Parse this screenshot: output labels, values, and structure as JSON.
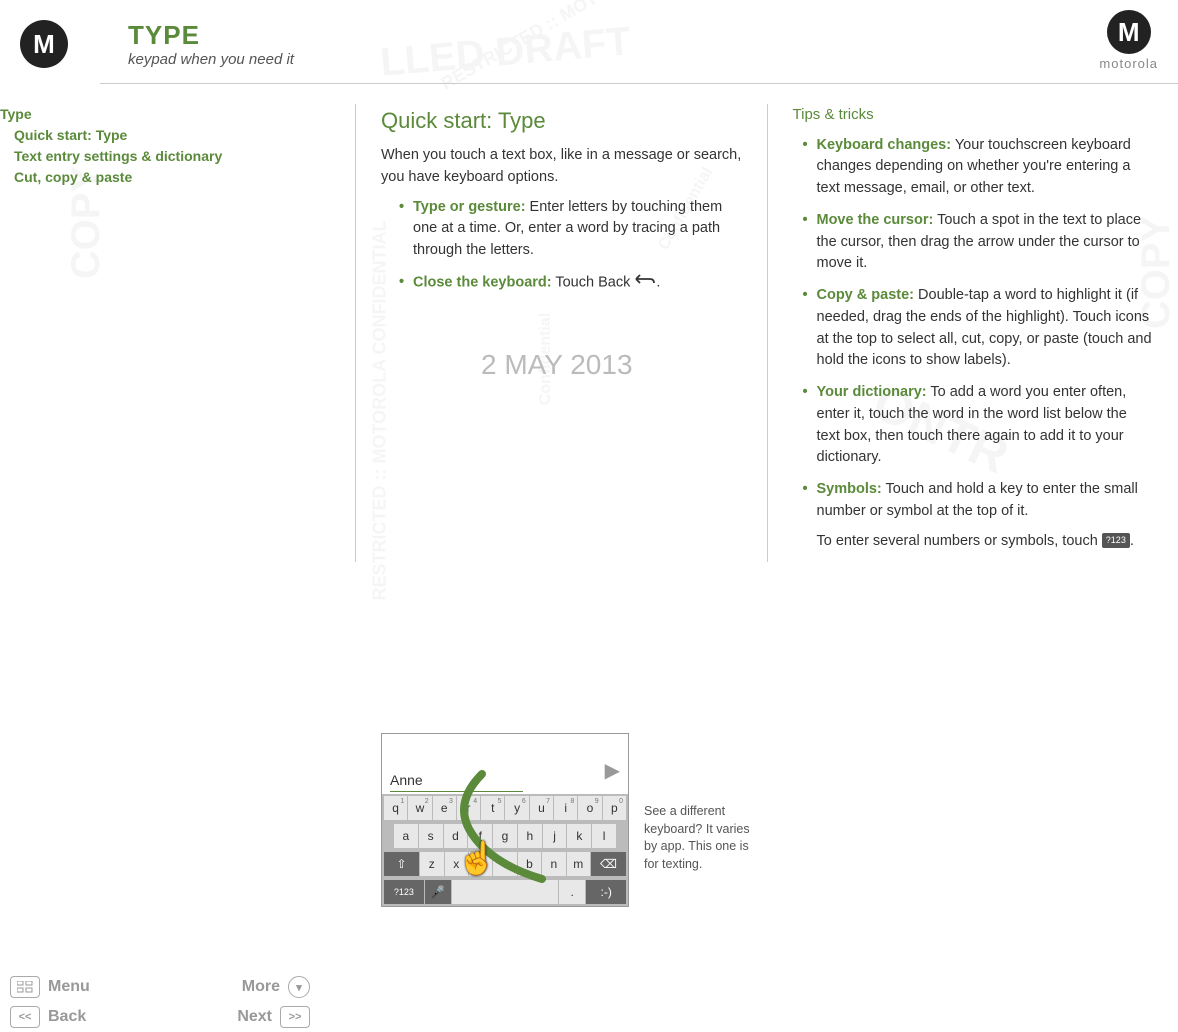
{
  "header": {
    "title": "TYPE",
    "subtitle": "keypad when you need it",
    "brand": "motorola"
  },
  "toc": {
    "root": "Type",
    "items": [
      "Quick start: Type",
      "Text entry settings & dictionary",
      "Cut, copy & paste"
    ]
  },
  "nav": {
    "menu": "Menu",
    "more": "More",
    "back": "Back",
    "next": "Next"
  },
  "col1": {
    "heading": "Quick start: Type",
    "intro": "When you touch a text box, like in a message or search, you have keyboard options.",
    "bullets": [
      {
        "label": "Type or gesture:",
        "text": " Enter letters by touching them one at a time. Or, enter a word by tracing a path through the letters."
      },
      {
        "label": "Close the keyboard:",
        "text": " Touch Back "
      }
    ],
    "date_stamp": "2 MAY 2013",
    "keyboard": {
      "typed": "Anne",
      "caption": "See a different keyboard? It varies by app. This one is for texting.",
      "row1": [
        [
          "q",
          "1"
        ],
        [
          "w",
          "2"
        ],
        [
          "e",
          "3"
        ],
        [
          "r",
          "4"
        ],
        [
          "t",
          "5"
        ],
        [
          "y",
          "6"
        ],
        [
          "u",
          "7"
        ],
        [
          "i",
          "8"
        ],
        [
          "o",
          "9"
        ],
        [
          "p",
          "0"
        ]
      ],
      "row2": [
        "a",
        "s",
        "d",
        "f",
        "g",
        "h",
        "j",
        "k",
        "l"
      ],
      "row3": [
        "z",
        "x",
        "c",
        "v",
        "b",
        "n",
        "m"
      ],
      "sym_key": "?123",
      "period": ".",
      "smiley": ":-)"
    }
  },
  "col2": {
    "heading": "Tips & tricks",
    "bullets": [
      {
        "label": "Keyboard changes:",
        "text": " Your touchscreen keyboard changes depending on whether you're entering a text message, email, or other text."
      },
      {
        "label": "Move the cursor:",
        "text": " Touch a spot in the text to place the cursor, then drag the arrow under the cursor to move it."
      },
      {
        "label": "Copy & paste:",
        "text": " Double-tap a word to highlight it (if needed, drag the ends of the highlight). Touch icons at the top to select all, cut, copy, or paste (touch and hold the icons to show labels)."
      },
      {
        "label": "Your dictionary:",
        "text": " To add a word you enter often, enter it, touch the word in the word list below the text box, then touch there again to add it to your dictionary."
      },
      {
        "label": "Symbols:",
        "text": " Touch and hold a key to enter the small number or symbol at the top of it."
      }
    ],
    "symbols_extra_pre": "To enter several numbers or symbols, touch ",
    "symbols_key": "?123",
    "symbols_extra_post": "."
  }
}
